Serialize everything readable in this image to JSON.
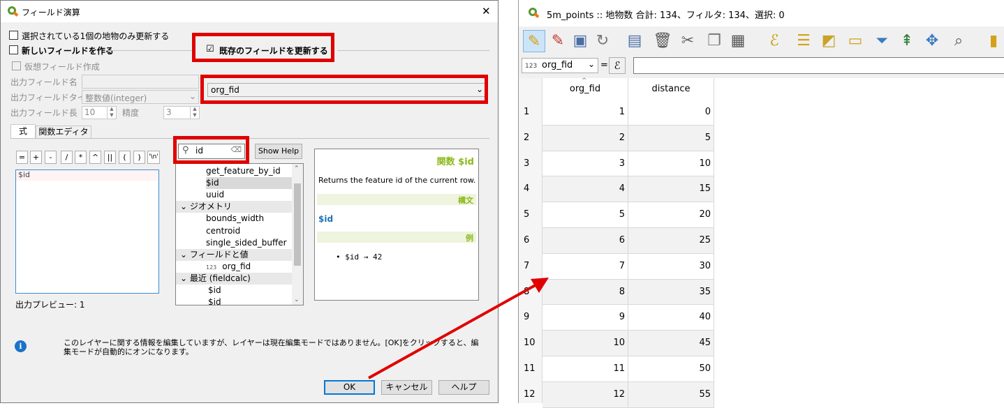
{
  "dialog": {
    "title": "フィールド演算",
    "close_glyph": "✕",
    "only_selected_label": "選択されている1個の地物のみ更新する",
    "new_field_label": "新しいフィールドを作る",
    "virtual_field_label": "仮想フィールド作成",
    "output_name_label": "出力フィールド名",
    "output_type_label": "出力フィールドタイプ",
    "output_type_value": "整数値(integer)",
    "output_length_label": "出力フィールド長",
    "output_length_value": "10",
    "precision_label": "精度",
    "precision_value": "3",
    "update_existing_label": "既存のフィールドを更新する",
    "update_existing_check": "☑",
    "existing_field_value": "org_fid",
    "tabs": [
      "式",
      "関数エディタ"
    ],
    "operators": [
      "=",
      "+",
      "-",
      "/",
      "*",
      "^",
      "||",
      "(",
      ")",
      "'\\n'"
    ],
    "expression_text": "$id",
    "search_value": "id",
    "show_help_label": "Show Help",
    "function_tree": [
      {
        "text": "get_feature_by_id",
        "kind": "item"
      },
      {
        "text": "$id",
        "kind": "item-selected"
      },
      {
        "text": "uuid",
        "kind": "item"
      },
      {
        "text": "ジオメトリ",
        "kind": "group"
      },
      {
        "text": "bounds_width",
        "kind": "item"
      },
      {
        "text": "centroid",
        "kind": "item"
      },
      {
        "text": "single_sided_buffer",
        "kind": "item"
      },
      {
        "text": "フィールドと値",
        "kind": "group"
      },
      {
        "text": "org_fid",
        "kind": "field",
        "prefix": "123"
      },
      {
        "text": "最近 (fieldcalc)",
        "kind": "group"
      },
      {
        "text": "$id",
        "kind": "item2"
      },
      {
        "text": "$id",
        "kind": "item2"
      }
    ],
    "help": {
      "title": "関数 $id",
      "description": "Returns the feature id of the current row.",
      "syntax_header": "構文",
      "syntax": "$id",
      "example_header": "例",
      "example": "$id → 42"
    },
    "preview_label": "出力プレビュー: 1",
    "info_message": "このレイヤーに関する情報を編集していますが、レイヤーは現在編集モードではありません。[OK]をクリックすると、編集モードが自動的にオンになります。",
    "ok_label": "OK",
    "cancel_label": "キャンセル",
    "help_label": "ヘルプ",
    "colors": {
      "highlight": "#e00000",
      "arrow": "#e00000",
      "help_accent": "#8bb919",
      "syntax_color": "#1f6fb5"
    }
  },
  "attribute_table": {
    "title": "5m_points :: 地物数 合計: 134、フィルタ: 134、選択: 0",
    "toolbar_icons": [
      "pencil-icon",
      "multi-edit-icon",
      "save-icon",
      "reload-icon",
      "add-feature-icon",
      "delete-icon",
      "cut-icon",
      "copy-icon",
      "paste-icon",
      "expression-select-icon",
      "select-all-icon",
      "invert-selection-icon",
      "deselect-icon",
      "filter-icon",
      "move-top-icon",
      "pan-to-selection-icon",
      "zoom-to-selection-icon",
      "more-icon"
    ],
    "field_selector": {
      "type_prefix": "123",
      "value": "org_fid",
      "equals": "=",
      "epsilon": "ℰ"
    },
    "columns": [
      "org_fid",
      "distance"
    ],
    "rows": [
      [
        "1",
        "1",
        "0"
      ],
      [
        "2",
        "2",
        "5"
      ],
      [
        "3",
        "3",
        "10"
      ],
      [
        "4",
        "4",
        "15"
      ],
      [
        "5",
        "5",
        "20"
      ],
      [
        "6",
        "6",
        "25"
      ],
      [
        "7",
        "7",
        "30"
      ],
      [
        "8",
        "8",
        "35"
      ],
      [
        "9",
        "9",
        "40"
      ],
      [
        "10",
        "10",
        "45"
      ],
      [
        "11",
        "11",
        "50"
      ],
      [
        "12",
        "12",
        "55"
      ]
    ]
  }
}
